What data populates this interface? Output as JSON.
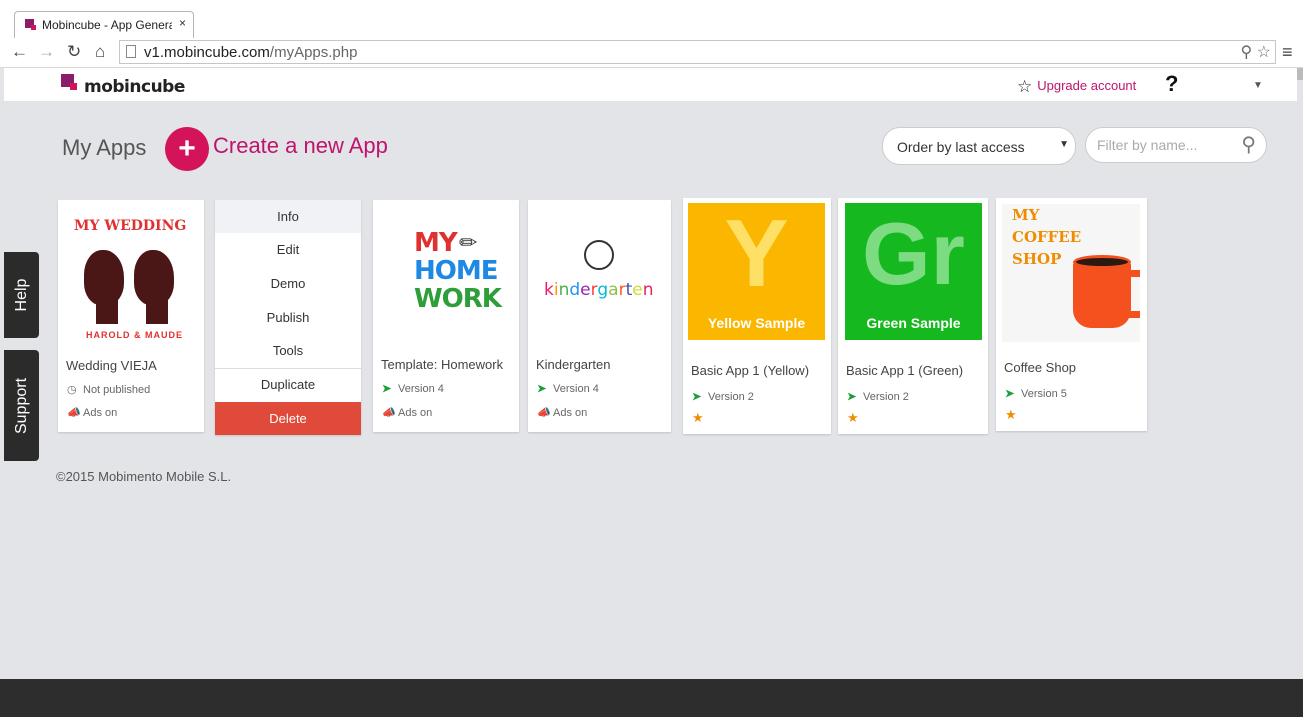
{
  "browser": {
    "tab_title": "Mobincube - App Generat",
    "tab_close": "×",
    "url_domain": "v1.mobincube.com",
    "url_path": "/myApps.php"
  },
  "header": {
    "logo_text": "mobincube",
    "upgrade_label": "Upgrade account",
    "help_label": "?"
  },
  "page": {
    "title": "My Apps",
    "create_label": "Create a new App",
    "order_label": "Order by last access",
    "filter_placeholder": "Filter by name..."
  },
  "side_tabs": {
    "help": "Help",
    "support": "Support"
  },
  "cards": {
    "wedding": {
      "name": "Wedding VIEJA",
      "status": "Not published",
      "ads": "Ads on",
      "thumb_title": "MY WEDDING",
      "thumb_sub": "HAROLD & MAUDE"
    },
    "menu": {
      "info": "Info",
      "edit": "Edit",
      "demo": "Demo",
      "publish": "Publish",
      "tools": "Tools",
      "duplicate": "Duplicate",
      "delete": "Delete"
    },
    "homework": {
      "name": "Template: Homework",
      "version": "Version 4",
      "ads": "Ads on",
      "thumb_l1": "MY",
      "thumb_l2": "HOME",
      "thumb_l3": "WORK"
    },
    "kindergarten": {
      "name": "Kindergarten",
      "version": "Version 4",
      "ads": "Ads on",
      "thumb_text": "kindergarten"
    },
    "yellow": {
      "name": "Basic App 1 (Yellow)",
      "version": "Version 2",
      "letter": "Y",
      "tile_label": "Yellow Sample"
    },
    "green": {
      "name": "Basic App 1 (Green)",
      "version": "Version 2",
      "letter": "Gr",
      "tile_label": "Green Sample"
    },
    "coffee": {
      "name": "Coffee Shop",
      "version": "Version 5",
      "thumb_l1": "MY",
      "thumb_l2": "COFFEE",
      "thumb_l3": "SHOP"
    }
  },
  "footer": {
    "copyright": "©2015 Mobimento Mobile S.L."
  },
  "colors": {
    "brand": "#c0136e",
    "accent": "#d4145a",
    "delete": "#e04a3a",
    "yellow": "#fbb600",
    "green": "#16b820"
  }
}
